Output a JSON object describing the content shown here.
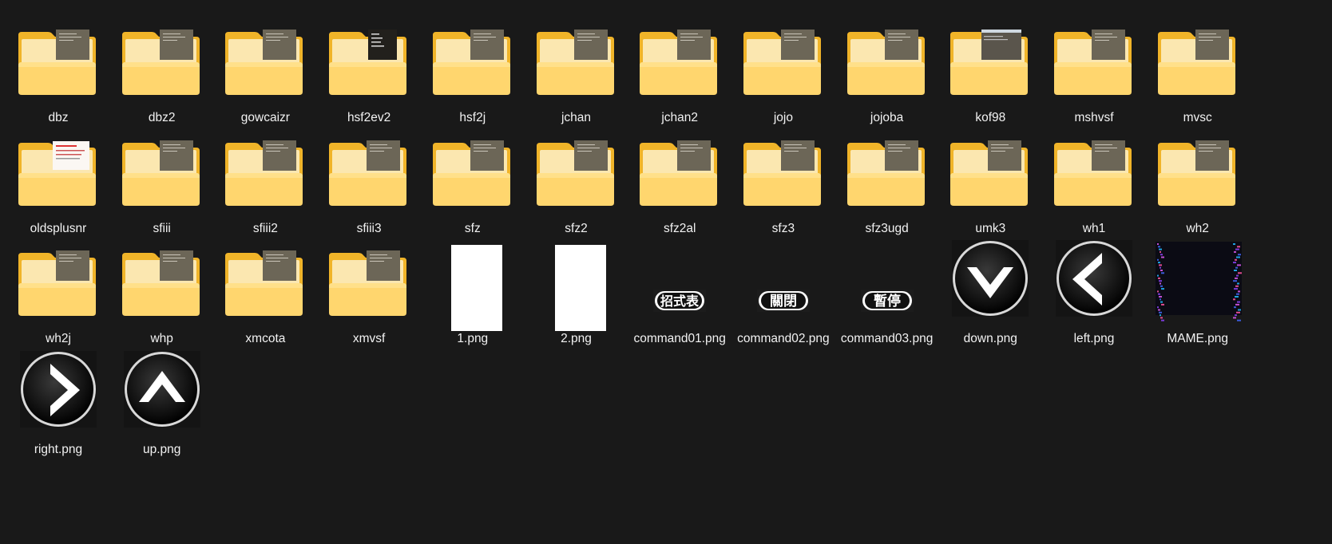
{
  "window": {
    "view": "Large icons"
  },
  "items": [
    {
      "name": "dbz",
      "kind": "folder",
      "preview": "dark-text"
    },
    {
      "name": "dbz2",
      "kind": "folder",
      "preview": "dark-text"
    },
    {
      "name": "gowcaizr",
      "kind": "folder",
      "preview": "dark-text"
    },
    {
      "name": "hsf2ev2",
      "kind": "folder",
      "preview": "black-text"
    },
    {
      "name": "hsf2j",
      "kind": "folder",
      "preview": "dark-text"
    },
    {
      "name": "jchan",
      "kind": "folder",
      "preview": "dark-text"
    },
    {
      "name": "jchan2",
      "kind": "folder",
      "preview": "dark-text"
    },
    {
      "name": "jojo",
      "kind": "folder",
      "preview": "dark-text"
    },
    {
      "name": "jojoba",
      "kind": "folder",
      "preview": "dark-text"
    },
    {
      "name": "kof98",
      "kind": "folder",
      "preview": "window"
    },
    {
      "name": "mshvsf",
      "kind": "folder",
      "preview": "dark-text"
    },
    {
      "name": "mvsc",
      "kind": "folder",
      "preview": "dark-text"
    },
    {
      "name": "oldsplusnr",
      "kind": "folder",
      "preview": "white-red"
    },
    {
      "name": "sfiii",
      "kind": "folder",
      "preview": "dark-text"
    },
    {
      "name": "sfiii2",
      "kind": "folder",
      "preview": "dark-text"
    },
    {
      "name": "sfiii3",
      "kind": "folder",
      "preview": "dark-text"
    },
    {
      "name": "sfz",
      "kind": "folder",
      "preview": "dark-text"
    },
    {
      "name": "sfz2",
      "kind": "folder",
      "preview": "dark-text"
    },
    {
      "name": "sfz2al",
      "kind": "folder",
      "preview": "dark-text"
    },
    {
      "name": "sfz3",
      "kind": "folder",
      "preview": "dark-text"
    },
    {
      "name": "sfz3ugd",
      "kind": "folder",
      "preview": "dark-text"
    },
    {
      "name": "umk3",
      "kind": "folder",
      "preview": "dark-text"
    },
    {
      "name": "wh1",
      "kind": "folder",
      "preview": "dark-text"
    },
    {
      "name": "wh2",
      "kind": "folder",
      "preview": "dark-text"
    },
    {
      "name": "wh2j",
      "kind": "folder",
      "preview": "dark-text"
    },
    {
      "name": "whp",
      "kind": "folder",
      "preview": "dark-text"
    },
    {
      "name": "xmcota",
      "kind": "folder",
      "preview": "dark-text"
    },
    {
      "name": "xmvsf",
      "kind": "folder",
      "preview": "dark-text"
    },
    {
      "name": "1.png",
      "kind": "white"
    },
    {
      "name": "2.png",
      "kind": "white"
    },
    {
      "name": "command01.png",
      "kind": "pill",
      "text": "招式表"
    },
    {
      "name": "command02.png",
      "kind": "pill",
      "text": "關閉"
    },
    {
      "name": "command03.png",
      "kind": "pill",
      "text": "暫停"
    },
    {
      "name": "down.png",
      "kind": "arrow",
      "dir": "down"
    },
    {
      "name": "left.png",
      "kind": "arrow",
      "dir": "left"
    },
    {
      "name": "MAME.png",
      "kind": "mame"
    },
    {
      "name": "right.png",
      "kind": "arrow",
      "dir": "right"
    },
    {
      "name": "up.png",
      "kind": "arrow",
      "dir": "up"
    }
  ],
  "colors": {
    "background": "#191919",
    "folder_back": "#f0b429",
    "folder_front": "#ffd66e",
    "label": "#f2f2f2"
  }
}
